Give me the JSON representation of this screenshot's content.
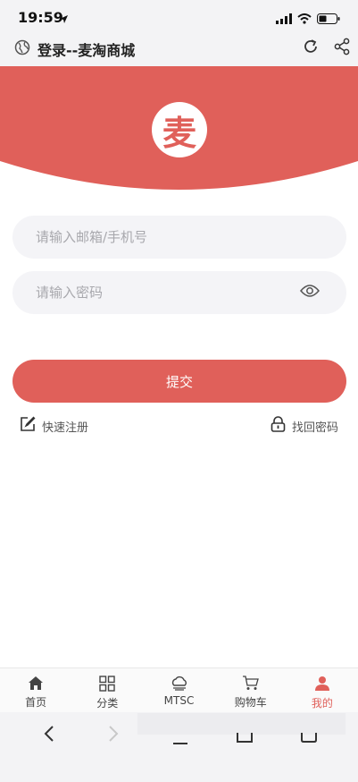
{
  "status_bar": {
    "time": "19:59"
  },
  "nav": {
    "title": "登录--麦淘商城"
  },
  "logo": {
    "char": "麦"
  },
  "form": {
    "email_placeholder": "请输入邮箱/手机号",
    "password_placeholder": "请输入密码",
    "submit_label": "提交"
  },
  "links": {
    "register": "快速注册",
    "forgot": "找回密码"
  },
  "tabs": [
    {
      "label": "首页",
      "icon": "home-icon",
      "active": false
    },
    {
      "label": "分类",
      "icon": "grid-icon",
      "active": false
    },
    {
      "label": "MTSC",
      "icon": "cloud-icon",
      "active": false
    },
    {
      "label": "购物车",
      "icon": "cart-icon",
      "active": false
    },
    {
      "label": "我的",
      "icon": "user-icon",
      "active": true
    }
  ],
  "colors": {
    "brand": "#e0605a",
    "tab_active": "#e0605a"
  }
}
